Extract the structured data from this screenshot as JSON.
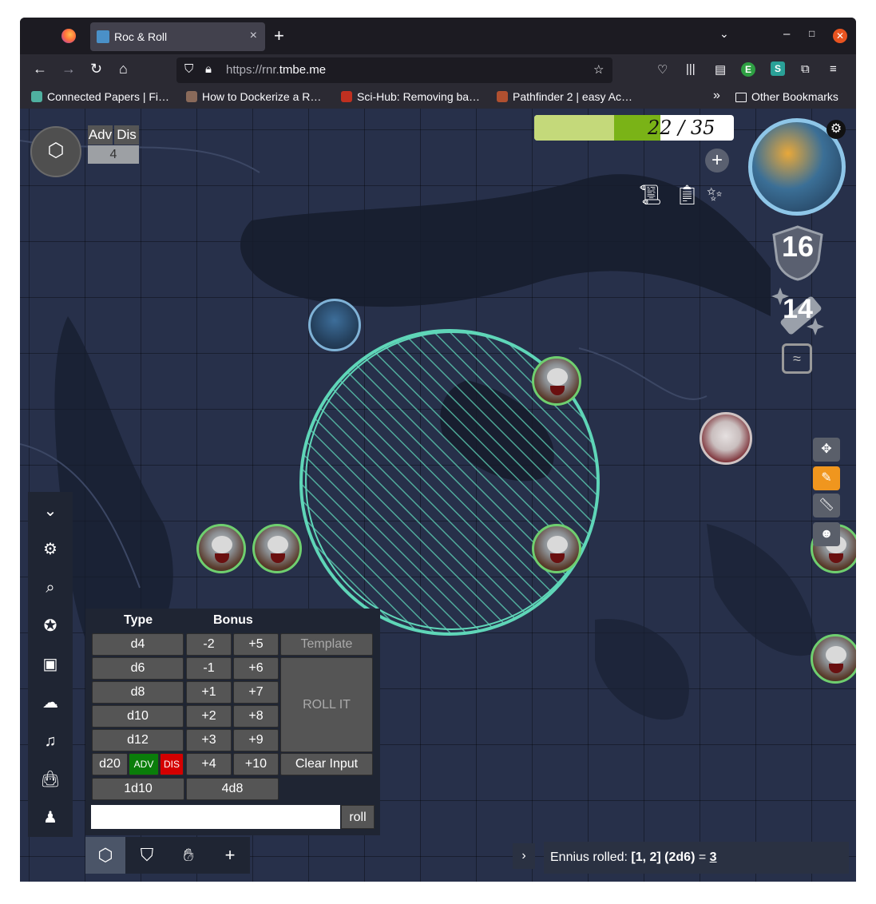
{
  "browser": {
    "tab_title": "Roc & Roll",
    "tab_close": "×",
    "new_tab": "+",
    "url_prefix": "https://rnr.",
    "url_domain": "tmbe.me",
    "bookmarks": [
      "Connected Papers | Fi…",
      "How to Dockerize a R…",
      "Sci-Hub: Removing ba…",
      "Pathfinder 2 | easy Ac…"
    ],
    "bookmarks_overflow": "»",
    "other_bookmarks": "Other Bookmarks"
  },
  "top_left": {
    "adv_label": "Adv",
    "dis_label": "Dis",
    "counter_value": "4"
  },
  "hp": {
    "text": "22 / 35",
    "current": 22,
    "max": 35
  },
  "character": {
    "armor_class": "16",
    "spell_stat": "14"
  },
  "dice_panel": {
    "type_header": "Type",
    "bonus_header": "Bonus",
    "dice": [
      "d4",
      "d6",
      "d8",
      "d10",
      "d12",
      "d20"
    ],
    "adv_label": "ADV",
    "dis_label": "DIS",
    "bonus_neg": [
      "-2",
      "-1",
      "+1",
      "+2",
      "+3",
      "+4"
    ],
    "bonus_pos": [
      "+5",
      "+6",
      "+7",
      "+8",
      "+9",
      "+10"
    ],
    "template_label": "Template",
    "roll_it_label": "ROLL IT",
    "clear_label": "Clear Input",
    "preset_1": "1d10",
    "preset_2": "4d8",
    "input_value": "",
    "roll_label": "roll"
  },
  "log": {
    "prefix": "Ennius rolled: ",
    "dice": "[1, 2] (2d6)",
    "equals": " = ",
    "result": "3"
  },
  "colors": {
    "hp_fill_light": "#c4d97a",
    "hp_fill_dark": "#7ab317",
    "aoe_circle": "#5fd6b8",
    "active_tool": "#f0961e",
    "adv_green": "#0a7d0a",
    "dis_red": "#d40000"
  }
}
